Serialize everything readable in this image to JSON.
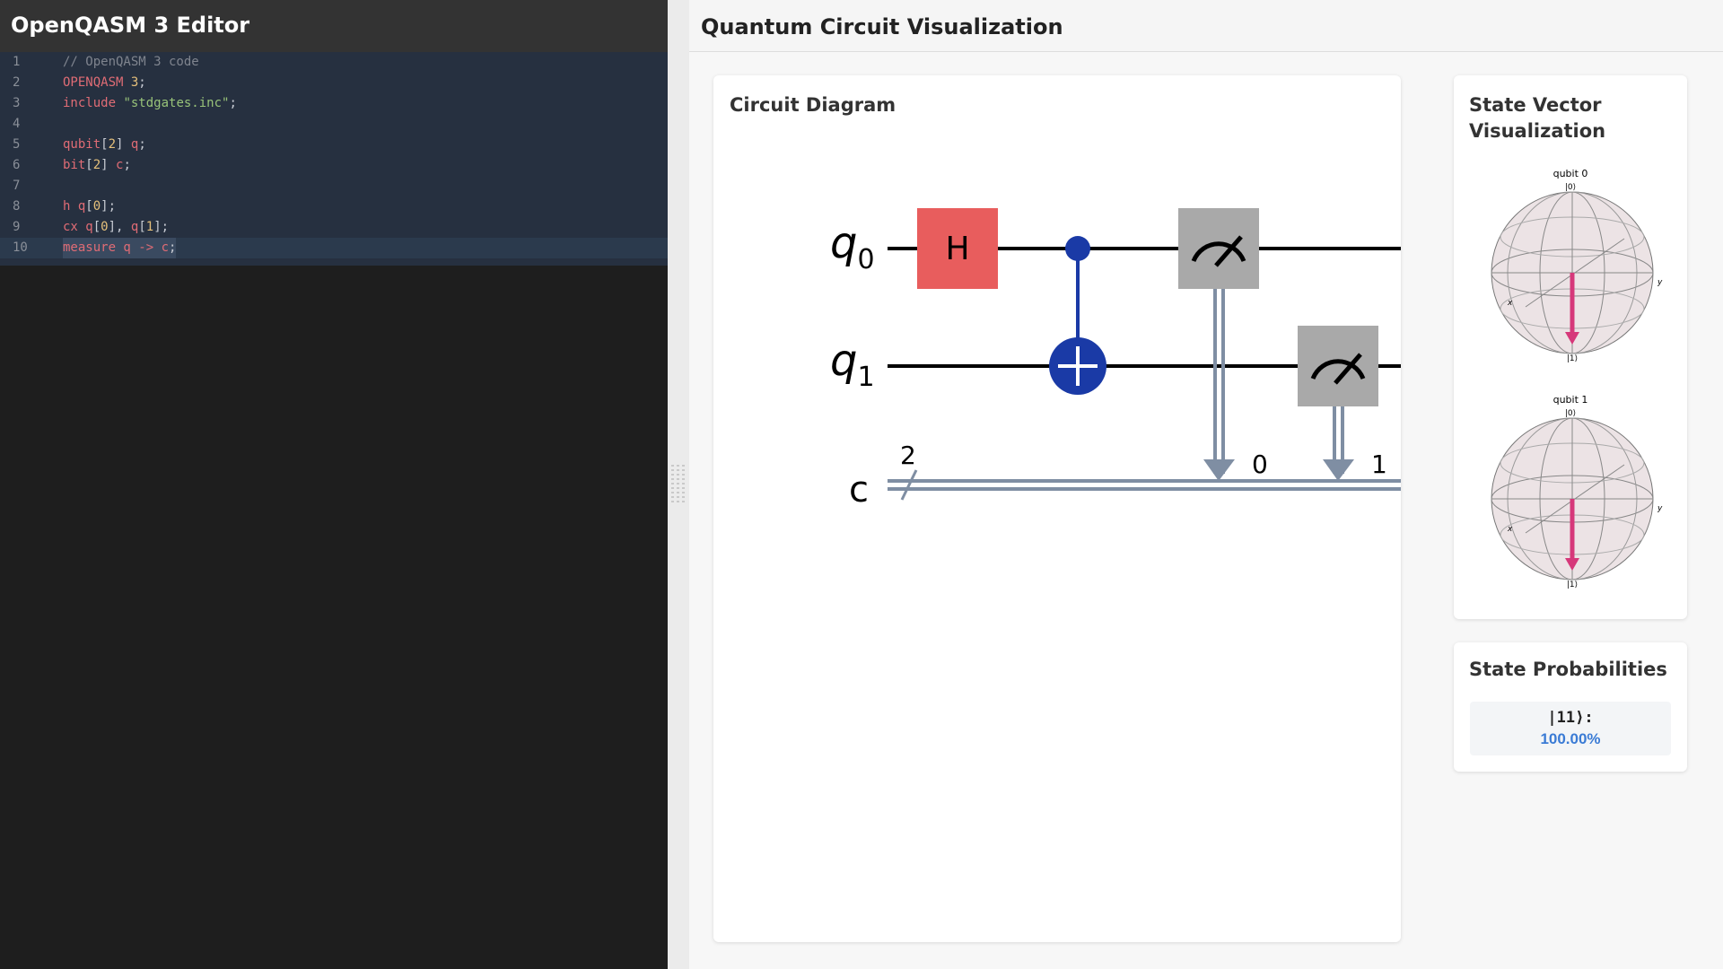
{
  "editor": {
    "title": "OpenQASM 3 Editor",
    "lines": [
      {
        "num": "1",
        "tokens": [
          {
            "t": "// OpenQASM 3 code",
            "c": "comment"
          }
        ]
      },
      {
        "num": "2",
        "tokens": [
          {
            "t": "OPENQASM ",
            "c": "keyword"
          },
          {
            "t": "3",
            "c": "number"
          },
          {
            "t": ";",
            "c": "punct"
          }
        ]
      },
      {
        "num": "3",
        "tokens": [
          {
            "t": "include ",
            "c": "keyword"
          },
          {
            "t": "\"stdgates.inc\"",
            "c": "string"
          },
          {
            "t": ";",
            "c": "punct"
          }
        ]
      },
      {
        "num": "4",
        "tokens": []
      },
      {
        "num": "5",
        "tokens": [
          {
            "t": "qubit",
            "c": "keyword"
          },
          {
            "t": "[",
            "c": "punct"
          },
          {
            "t": "2",
            "c": "number"
          },
          {
            "t": "] ",
            "c": "punct"
          },
          {
            "t": "q",
            "c": "keyword"
          },
          {
            "t": ";",
            "c": "punct"
          }
        ]
      },
      {
        "num": "6",
        "tokens": [
          {
            "t": "bit",
            "c": "keyword"
          },
          {
            "t": "[",
            "c": "punct"
          },
          {
            "t": "2",
            "c": "number"
          },
          {
            "t": "] ",
            "c": "punct"
          },
          {
            "t": "c",
            "c": "keyword"
          },
          {
            "t": ";",
            "c": "punct"
          }
        ]
      },
      {
        "num": "7",
        "tokens": []
      },
      {
        "num": "8",
        "tokens": [
          {
            "t": "h ",
            "c": "keyword"
          },
          {
            "t": "q",
            "c": "keyword"
          },
          {
            "t": "[",
            "c": "punct"
          },
          {
            "t": "0",
            "c": "number"
          },
          {
            "t": "];",
            "c": "punct"
          }
        ]
      },
      {
        "num": "9",
        "tokens": [
          {
            "t": "cx ",
            "c": "keyword"
          },
          {
            "t": "q",
            "c": "keyword"
          },
          {
            "t": "[",
            "c": "punct"
          },
          {
            "t": "0",
            "c": "number"
          },
          {
            "t": "], ",
            "c": "punct"
          },
          {
            "t": "q",
            "c": "keyword"
          },
          {
            "t": "[",
            "c": "punct"
          },
          {
            "t": "1",
            "c": "number"
          },
          {
            "t": "];",
            "c": "punct"
          }
        ]
      },
      {
        "num": "10",
        "tokens": [
          {
            "t": "measure q -> c",
            "c": "keyword"
          },
          {
            "t": ";",
            "c": "punct"
          }
        ],
        "active": true
      }
    ]
  },
  "visualization": {
    "title": "Quantum Circuit Visualization",
    "circuit_card": {
      "title": "Circuit Diagram",
      "qubit_labels": [
        "q",
        "q"
      ],
      "qubit_subscripts": [
        "0",
        "1"
      ],
      "classical_label": "c",
      "classical_width": "2",
      "gates": {
        "hadamard": "H"
      },
      "measure_targets": [
        "0",
        "1"
      ]
    },
    "state_card": {
      "title": "State Vector Visualization",
      "spheres": [
        {
          "label": "qubit 0",
          "ket_top": "|0⟩",
          "ket_bottom": "|1⟩",
          "axis_x": "x",
          "axis_y": "y"
        },
        {
          "label": "qubit 1",
          "ket_top": "|0⟩",
          "ket_bottom": "|1⟩",
          "axis_x": "x",
          "axis_y": "y"
        }
      ]
    },
    "prob_card": {
      "title": "State Probabilities",
      "state": "|11⟩:",
      "value": "100.00%"
    }
  },
  "colors": {
    "hadamard": "#e85d5d",
    "control": "#1a3aa6",
    "measure": "#a9a9a9",
    "classical": "#7f8ea3",
    "bloch_vector": "#d6387a",
    "probability": "#3a7bd5"
  }
}
